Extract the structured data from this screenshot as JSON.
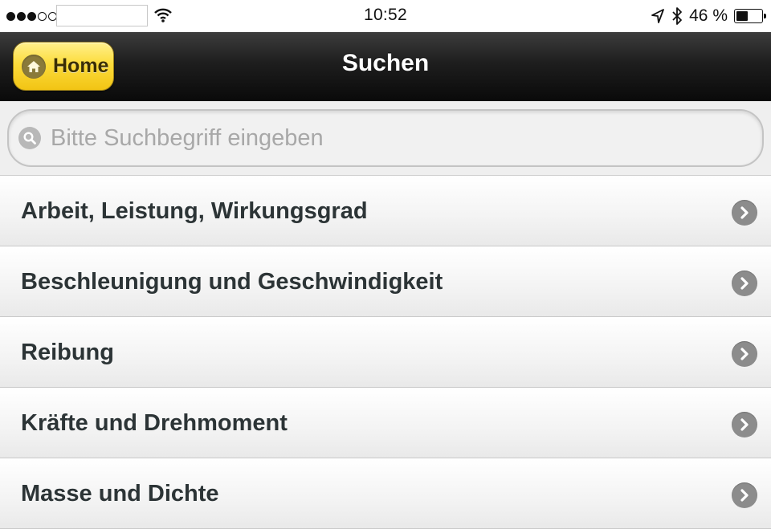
{
  "status_bar": {
    "time": "10:52",
    "battery_percent": "46 %",
    "battery_level": 0.46,
    "signal_bars_filled": 3,
    "signal_bars_total": 5
  },
  "header": {
    "title": "Suchen",
    "home_label": "Home"
  },
  "search": {
    "placeholder": "Bitte Suchbegriff eingeben",
    "value": ""
  },
  "list": {
    "items": [
      {
        "label": "Arbeit, Leistung, Wirkungsgrad"
      },
      {
        "label": "Beschleunigung und Geschwindigkeit"
      },
      {
        "label": "Reibung"
      },
      {
        "label": "Kräfte und Drehmoment"
      },
      {
        "label": "Masse und Dichte"
      }
    ]
  },
  "colors": {
    "header_bg": "#1a1a1a",
    "home_button": "#fcdc3c",
    "item_text": "#2c3436",
    "chevron": "#8c8c8c"
  },
  "icons": [
    "wifi-icon",
    "location-arrow-icon",
    "bluetooth-icon",
    "battery-icon",
    "home-icon",
    "search-icon",
    "chevron-right-icon"
  ]
}
